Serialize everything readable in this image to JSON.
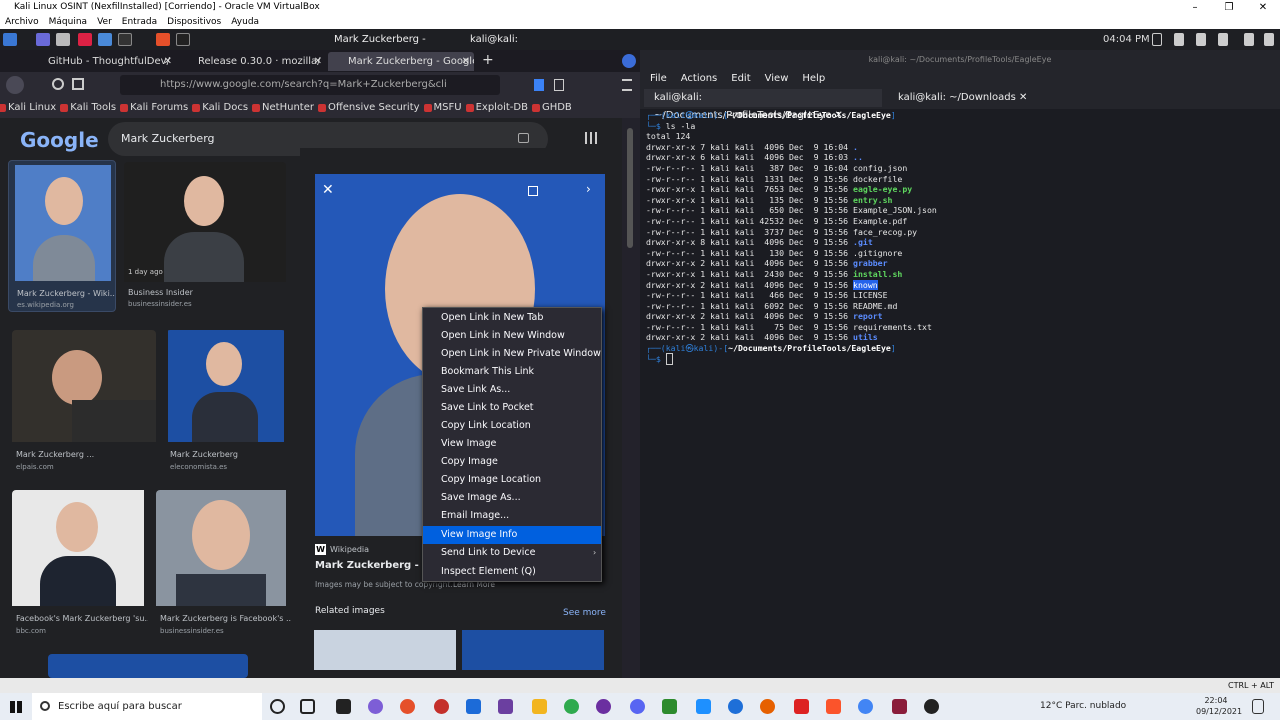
{
  "vbox": {
    "title": "Kali Linux OSINT (NexfilInstalled) [Corriendo] - Oracle VM VirtualBox",
    "menu": [
      "Archivo",
      "Máquina",
      "Ver",
      "Entrada",
      "Dispositivos",
      "Ayuda"
    ],
    "min": "–",
    "max": "❐",
    "close": "✕"
  },
  "kali_panel": {
    "task1": "Mark Zuckerberg - Goog...",
    "task2": "kali@kali: ~/Documents...",
    "clock": "04:04 PM"
  },
  "firefox": {
    "tabs": [
      {
        "label": "GitHub - ThoughtfulDev/",
        "close": "✕"
      },
      {
        "label": "Release 0.30.0 · mozilla/",
        "close": "✕"
      },
      {
        "label": "Mark Zuckerberg - Google",
        "close": "✕"
      }
    ],
    "newtab": "+",
    "url": "https://www.google.com/search?q=Mark+Zuckerberg&cli",
    "bookmarks": [
      "Kali Linux",
      "Kali Tools",
      "Kali Forums",
      "Kali Docs",
      "NetHunter",
      "Offensive Security",
      "MSFU",
      "Exploit-DB",
      "GHDB"
    ]
  },
  "google": {
    "logo": "Google",
    "query": "Mark Zuckerberg",
    "results": [
      {
        "caption": "Mark Zuckerberg - Wiki...",
        "source": "es.wikipedia.org"
      },
      {
        "caption": "Business Insider",
        "source": "businessinsider.es",
        "badge": "1 day ago"
      },
      {
        "caption": "Mark Zuckerberg ...",
        "source": "elpais.com"
      },
      {
        "caption": "Mark Zuckerberg",
        "source": "eleconomista.es"
      },
      {
        "caption": "Facebook's Mark Zuckerberg 'su...",
        "source": "bbc.com"
      },
      {
        "caption": "Mark Zuckerberg is Facebook's ...",
        "source": "businessinsider.es"
      }
    ],
    "preview": {
      "source": "Wikipedia",
      "title": "Mark Zuckerberg - Wiki",
      "copyright": "Images may be subject to copyright.",
      "learn_more": "Learn More",
      "related": "Related images",
      "see_more": "See more"
    }
  },
  "context_menu": [
    "Open Link in New Tab",
    "Open Link in New Window",
    "Open Link in New Private Window",
    "Bookmark This Link",
    "Save Link As...",
    "Save Link to Pocket",
    "Copy Link Location",
    "View Image",
    "Copy Image",
    "Copy Image Location",
    "Save Image As...",
    "Email Image...",
    "View Image Info",
    "Send Link to Device",
    "Inspect Element (Q)"
  ],
  "terminal": {
    "title": "kali@kali: ~/Documents/ProfileTools/EagleEye",
    "menu": [
      "File",
      "Actions",
      "Edit",
      "View",
      "Help"
    ],
    "tabs": [
      {
        "label": "kali@kali: ~/Documents/ProfileTools/EagleEye",
        "close": "✕"
      },
      {
        "label": "kali@kali: ~/Downloads",
        "close": "✕"
      }
    ],
    "prompt_user": "(kali㉿kali)-[",
    "prompt_path": "~/Documents/ProfileTools/EagleEye",
    "prompt_end": "]",
    "command": "ls -la",
    "total": "total 124",
    "entries": [
      {
        "meta": "drwxr-xr-x 7 kali kali  4096 Dec  9 16:04",
        "name": ".",
        "type": "dir"
      },
      {
        "meta": "drwxr-xr-x 6 kali kali  4096 Dec  9 16:03",
        "name": "..",
        "type": "dir"
      },
      {
        "meta": "-rw-r--r-- 1 kali kali   387 Dec  9 16:04",
        "name": "config.json",
        "type": "file"
      },
      {
        "meta": "-rw-r--r-- 1 kali kali  1331 Dec  9 15:56",
        "name": "dockerfile",
        "type": "file"
      },
      {
        "meta": "-rwxr-xr-x 1 kali kali  7653 Dec  9 15:56",
        "name": "eagle-eye.py",
        "type": "exe"
      },
      {
        "meta": "-rwxr-xr-x 1 kali kali   135 Dec  9 15:56",
        "name": "entry.sh",
        "type": "exe"
      },
      {
        "meta": "-rw-r--r-- 1 kali kali   650 Dec  9 15:56",
        "name": "Example_JSON.json",
        "type": "file"
      },
      {
        "meta": "-rw-r--r-- 1 kali kali 42532 Dec  9 15:56",
        "name": "Example.pdf",
        "type": "file"
      },
      {
        "meta": "-rw-r--r-- 1 kali kali  3737 Dec  9 15:56",
        "name": "face_recog.py",
        "type": "file"
      },
      {
        "meta": "drwxr-xr-x 8 kali kali  4096 Dec  9 15:56",
        "name": ".git",
        "type": "dir"
      },
      {
        "meta": "-rw-r--r-- 1 kali kali   130 Dec  9 15:56",
        "name": ".gitignore",
        "type": "file"
      },
      {
        "meta": "drwxr-xr-x 2 kali kali  4096 Dec  9 15:56",
        "name": "grabber",
        "type": "dir"
      },
      {
        "meta": "-rwxr-xr-x 1 kali kali  2430 Dec  9 15:56",
        "name": "install.sh",
        "type": "exe"
      },
      {
        "meta": "drwxr-xr-x 2 kali kali  4096 Dec  9 15:56",
        "name": "known",
        "type": "hi"
      },
      {
        "meta": "-rw-r--r-- 1 kali kali   466 Dec  9 15:56",
        "name": "LICENSE",
        "type": "file"
      },
      {
        "meta": "-rw-r--r-- 1 kali kali  6092 Dec  9 15:56",
        "name": "README.md",
        "type": "file"
      },
      {
        "meta": "drwxr-xr-x 2 kali kali  4096 Dec  9 15:56",
        "name": "report",
        "type": "dir"
      },
      {
        "meta": "-rw-r--r-- 1 kali kali    75 Dec  9 15:56",
        "name": "requirements.txt",
        "type": "file"
      },
      {
        "meta": "drwxr-xr-x 2 kali kali  4096 Dec  9 15:56",
        "name": "utils",
        "type": "dir"
      }
    ]
  },
  "vbox_status": {
    "host_key": "CTRL + ALT"
  },
  "taskbar": {
    "search": "Escribe aquí para buscar",
    "weather": "12°C  Parc. nublado",
    "time": "22:04",
    "date": "09/12/2021"
  },
  "colors": {
    "highlight": "#0060df",
    "dir": "#5b8cff",
    "exe": "#5fd75f",
    "terminal_bg": "#1b1c22"
  }
}
